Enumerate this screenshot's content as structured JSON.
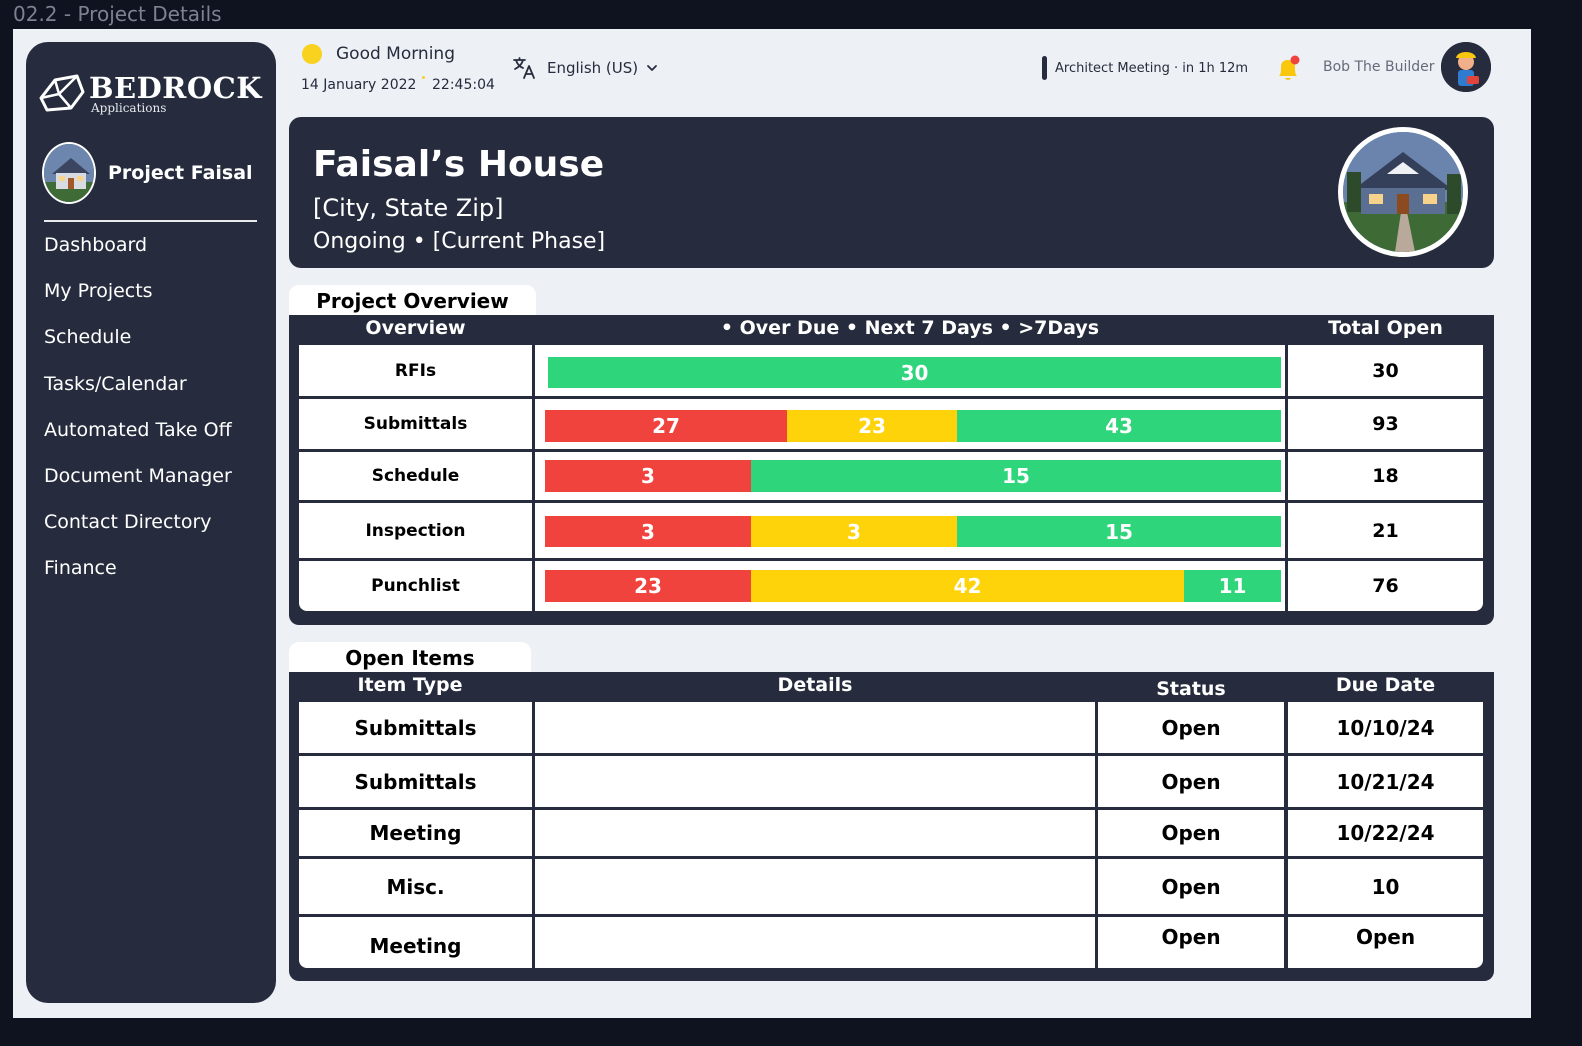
{
  "frame_title": "02.2 - Project Details",
  "brand": {
    "name": "BEDROCK",
    "sub": "Applications"
  },
  "project": {
    "name": "Project Faisal"
  },
  "nav": [
    "Dashboard",
    "My Projects",
    "Schedule",
    "Tasks/Calendar",
    "Automated Take Off",
    "Document Manager",
    "Contact Directory",
    "Finance"
  ],
  "topbar": {
    "greeting": "Good Morning",
    "date": "14 January 2022",
    "time": "22:45:04",
    "language": "English (US)",
    "meeting": "Architect Meeting · in 1h 12m",
    "user_name": "Bob The Builder"
  },
  "hero": {
    "title": "Faisal’s House",
    "location": "[City, State Zip]",
    "status": "Ongoing •  [Current Phase]"
  },
  "overview": {
    "tab": "Project Overview",
    "headers": {
      "overview": "Overview",
      "legend": "•  Over Due •  Next 7 Days • >7Days",
      "total": "Total Open"
    },
    "rows": [
      {
        "label": "RFIs",
        "overdue": "",
        "next7": "",
        "later": "30",
        "total": "30"
      },
      {
        "label": "Submittals",
        "overdue": "27",
        "next7": "23",
        "later": "43",
        "total": "93"
      },
      {
        "label": "Schedule",
        "overdue": "3",
        "next7": "",
        "later": "15",
        "total": "18"
      },
      {
        "label": "Inspection",
        "overdue": "3",
        "next7": "3",
        "later": "15",
        "total": "21"
      },
      {
        "label": "Punchlist",
        "overdue": "23",
        "next7": "42",
        "later": "11",
        "total": "76"
      }
    ],
    "colors": {
      "overdue": "#f0433e",
      "next7": "#ffd30a",
      "later": "#2fd57b"
    }
  },
  "open_items": {
    "tab": "Open Items",
    "headers": {
      "type": "Item Type",
      "details": "Details",
      "status": "Status",
      "due": "Due Date"
    },
    "rows": [
      {
        "type": "Submittals",
        "details": "",
        "status": "Open",
        "due": "10/10/24"
      },
      {
        "type": "Submittals",
        "details": "",
        "status": "Open",
        "due": "10/21/24"
      },
      {
        "type": "Meeting",
        "details": "",
        "status": "Open",
        "due": "10/22/24"
      },
      {
        "type": "Misc.",
        "details": "",
        "status": "Open",
        "due": "10"
      },
      {
        "type": "Meeting",
        "details": "",
        "status": "Open",
        "due": "Open"
      }
    ]
  }
}
